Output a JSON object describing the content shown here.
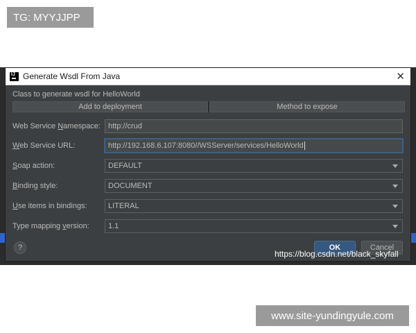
{
  "badges": {
    "top_left": "TG: MYYJJPP",
    "bottom_right": "www.site-yundingyule.com"
  },
  "dialog": {
    "title": "Generate Wsdl From Java",
    "subtitle": "Class to generate wsdl for HelloWorld",
    "tabs": [
      {
        "label": "Add to deployment"
      },
      {
        "label": "Method to expose"
      }
    ],
    "fields": {
      "namespace": {
        "label_pre": "Web Service ",
        "label_mn": "N",
        "label_post": "amespace:",
        "value": "http://crud"
      },
      "url": {
        "label_pre": "",
        "label_mn": "W",
        "label_post": "eb Service URL:",
        "value": "http://192.168.6.107:8080//WSServer/services/HelloWorld"
      },
      "soap_action": {
        "label_pre": "",
        "label_mn": "S",
        "label_post": "oap action:",
        "value": "DEFAULT"
      },
      "binding_style": {
        "label_pre": "",
        "label_mn": "B",
        "label_post": "inding style:",
        "value": "DOCUMENT"
      },
      "use_items": {
        "label_pre": "",
        "label_mn": "U",
        "label_post": "se items in bindings:",
        "value": "LITERAL"
      },
      "type_mapping": {
        "label_pre": "Type mapping ",
        "label_mn": "v",
        "label_post": "ersion:",
        "value": "1.1"
      }
    },
    "buttons": {
      "help": "?",
      "ok": "OK",
      "cancel": "Cancel",
      "close": "✕"
    }
  },
  "watermark": "https://blog.csdn.net/black_skyfall",
  "colors": {
    "dialog_bg": "#3c3f41",
    "ok_button": "#365880",
    "focus_border": "#3d6185"
  }
}
